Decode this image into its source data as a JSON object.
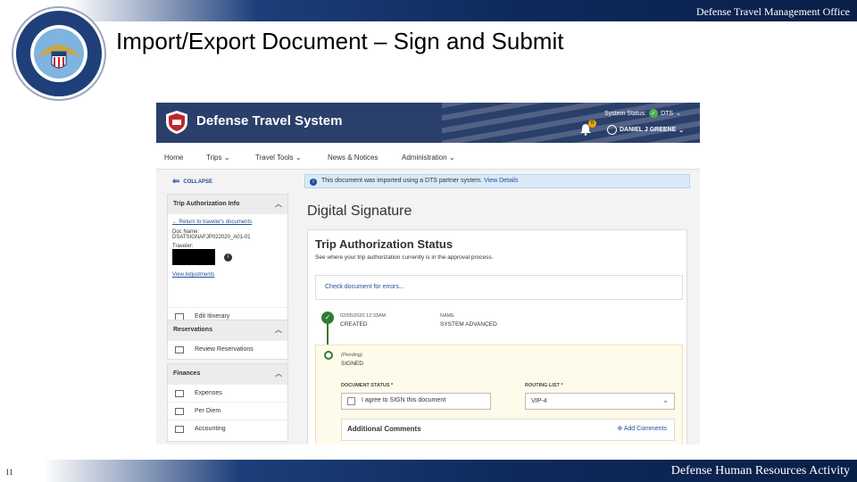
{
  "slide": {
    "header_org": "Defense Travel Management Office",
    "title": "Import/Export Document – Sign and Submit",
    "footer_org": "Defense Human Resources Activity",
    "page_number": "11"
  },
  "app": {
    "name": "Defense Travel System",
    "system_status_label": "System Status:",
    "system_status_value": "DTS",
    "notification_count": "0",
    "user_name": "DANIEL J GREENE"
  },
  "nav": {
    "items": [
      "Home",
      "Trips",
      "Travel Tools",
      "News & Notices",
      "Administration"
    ]
  },
  "sidebar": {
    "collapse": "COLLAPSE",
    "trip_info": {
      "heading": "Trip Authorization Info",
      "return_link": "Return to traveler's documents",
      "doc_name_label": "Doc Name:",
      "doc_name": "DSATSIGNAFJP022020_A01-01",
      "traveler_label": "Traveler:",
      "view_adjustments": "View Adjustments",
      "edit_itinerary": "Edit Itinerary"
    },
    "reservations": {
      "heading": "Reservations",
      "items": [
        "Review Reservations"
      ]
    },
    "finances": {
      "heading": "Finances",
      "items": [
        "Expenses",
        "Per Diem",
        "Accounting"
      ]
    }
  },
  "main": {
    "banner_text": "This document was imported using a DTS partner system.",
    "banner_link": "View Details",
    "page_heading": "Digital Signature",
    "status_card": {
      "title": "Trip Authorization Status",
      "subtitle": "See where your trip authorization currently is in the approval process.",
      "check_errors": "Check document for errors...",
      "step1": {
        "datetime": "02/05/2020 12:33AM",
        "status": "CREATED",
        "name_label": "NAME",
        "name": "SYSTEM ADVANCED"
      },
      "step2": {
        "state": "(Pending)",
        "status": "SIGNED",
        "doc_status_label": "DOCUMENT STATUS *",
        "agree_text": "I agree to SIGN this document",
        "routing_label": "ROUTING LIST *",
        "routing_value": "VIP-4",
        "additional_comments": "Additional Comments",
        "add_comments": "Add Comments"
      }
    }
  }
}
